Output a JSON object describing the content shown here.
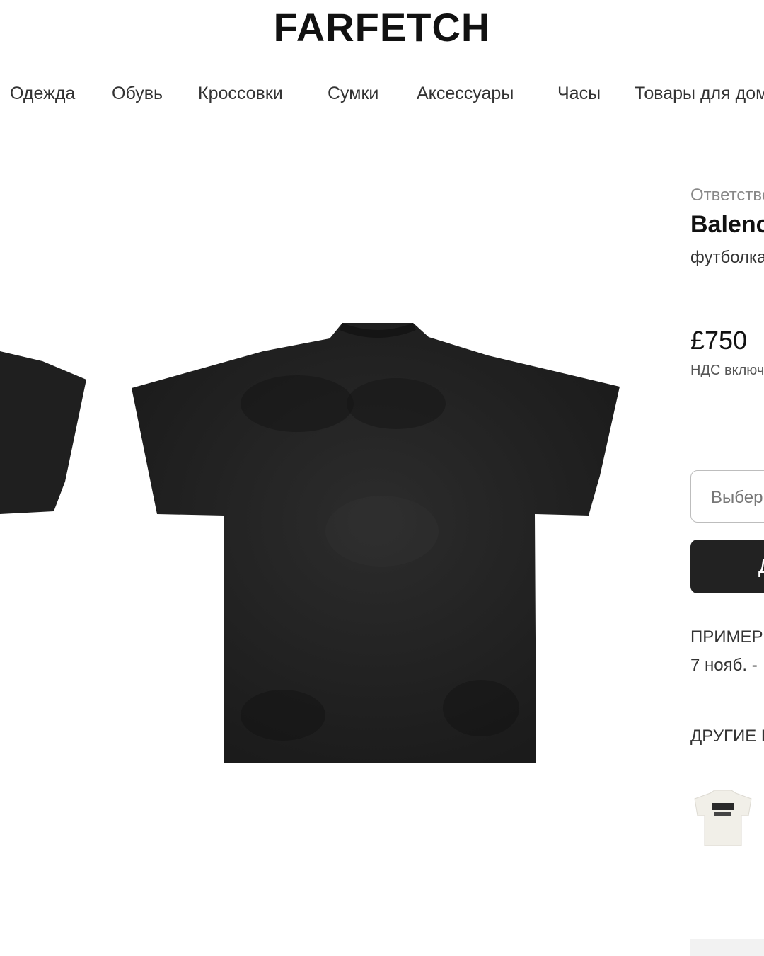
{
  "logo": "FARFETCH",
  "nav": {
    "items": [
      "Одежда",
      "Обувь",
      "Кроссовки",
      "Сумки",
      "Аксессуары",
      "Часы",
      "Товары для дома"
    ]
  },
  "product": {
    "image_alt_icon": "black-tshirt-back-image",
    "seller_label": "Ответственный",
    "brand": "Balenciaga",
    "description": "футболка",
    "price": "£750",
    "vat_note": "НДС включен",
    "size_placeholder": "Выберите размер",
    "add_button_label": "Добавить в корзину",
    "delivery_title": "ПРИМЕРНАЯ ДАТА ДОСТАВКИ",
    "delivery_date": "7 нояб. -",
    "other_title": "ДРУГИЕ ЦВЕТА",
    "thumb_icon": "white-tshirt-thumbnail"
  }
}
